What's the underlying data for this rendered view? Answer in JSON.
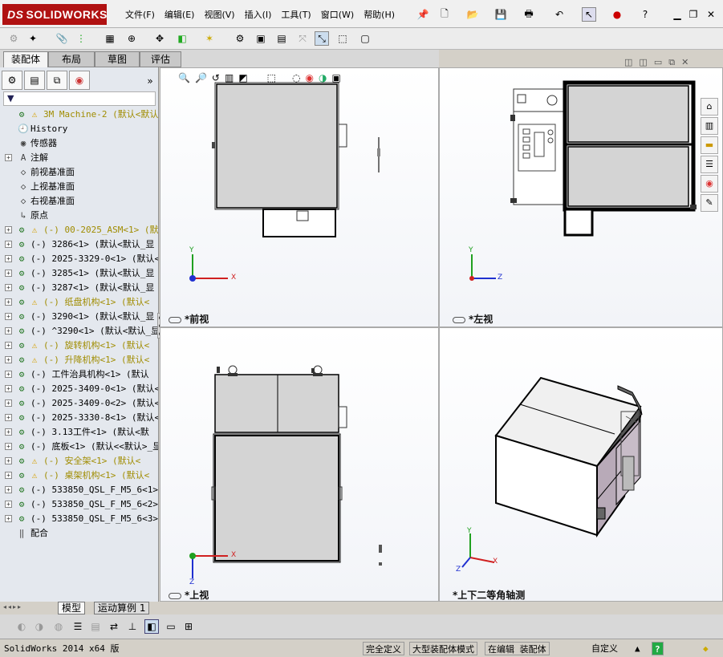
{
  "app": {
    "logo_prefix": "DS",
    "logo_text": "SOLIDWORKS"
  },
  "menu": [
    "文件(F)",
    "编辑(E)",
    "视图(V)",
    "插入(I)",
    "工具(T)",
    "窗口(W)",
    "帮助(H)"
  ],
  "command_tabs": [
    "装配体",
    "布局",
    "草图",
    "评估"
  ],
  "tree": {
    "filter_icon": "filter-icon",
    "items": [
      {
        "label": "3M Machine-2  (默认<默认_显",
        "icon": "assembly-icon",
        "warn": true,
        "expand": false
      },
      {
        "label": "History",
        "icon": "history-icon",
        "warn": false,
        "expand": false
      },
      {
        "label": "传感器",
        "icon": "sensor-icon",
        "warn": false,
        "expand": false
      },
      {
        "label": "注解",
        "icon": "annotation-icon",
        "warn": false,
        "expand": true
      },
      {
        "label": "前视基准面",
        "icon": "plane-icon",
        "warn": false,
        "expand": false
      },
      {
        "label": "上视基准面",
        "icon": "plane-icon",
        "warn": false,
        "expand": false
      },
      {
        "label": "右视基准面",
        "icon": "plane-icon",
        "warn": false,
        "expand": false
      },
      {
        "label": "原点",
        "icon": "origin-icon",
        "warn": false,
        "expand": false
      },
      {
        "label": "(-) 00-2025_ASM<1> (默认",
        "icon": "assembly-icon",
        "warn": true,
        "expand": true
      },
      {
        "label": "(-) 3286<1> (默认<默认_显",
        "icon": "part-icon",
        "warn": false,
        "expand": true
      },
      {
        "label": "(-) 2025-3329-0<1> (默认<",
        "icon": "part-icon",
        "warn": false,
        "expand": true
      },
      {
        "label": "(-) 3285<1> (默认<默认_显",
        "icon": "part-icon",
        "warn": false,
        "expand": true
      },
      {
        "label": "(-) 3287<1> (默认<默认_显",
        "icon": "part-icon",
        "warn": false,
        "expand": true
      },
      {
        "label": "(-) 纸盘机构<1> (默认<",
        "icon": "assembly-icon",
        "warn": true,
        "expand": true
      },
      {
        "label": "(-) 3290<1> (默认<默认_显",
        "icon": "part-icon",
        "warn": false,
        "expand": true
      },
      {
        "label": "(-) ^3290<1> (默认<默认_显",
        "icon": "part-icon",
        "warn": false,
        "expand": true
      },
      {
        "label": "(-) 旋转机构<1> (默认<",
        "icon": "assembly-icon",
        "warn": true,
        "expand": true
      },
      {
        "label": "(-) 升降机构<1> (默认<",
        "icon": "assembly-icon",
        "warn": true,
        "expand": true
      },
      {
        "label": "(-) 工件治具机构<1> (默认",
        "icon": "part-icon",
        "warn": false,
        "expand": true
      },
      {
        "label": "(-) 2025-3409-0<1> (默认<",
        "icon": "part-icon",
        "warn": false,
        "expand": true
      },
      {
        "label": "(-) 2025-3409-0<2> (默认<",
        "icon": "part-icon",
        "warn": false,
        "expand": true
      },
      {
        "label": "(-) 2025-3330-8<1> (默认<",
        "icon": "part-icon",
        "warn": false,
        "expand": true
      },
      {
        "label": "(-) 3.13工件<1> (默认<默",
        "icon": "part-icon",
        "warn": false,
        "expand": true
      },
      {
        "label": "(-) 底板<1> (默认<<默认>_显",
        "icon": "part-icon",
        "warn": false,
        "expand": true
      },
      {
        "label": "(-) 安全架<1> (默认<",
        "icon": "assembly-icon",
        "warn": true,
        "expand": true
      },
      {
        "label": "(-) 桌架机构<1> (默认<",
        "icon": "assembly-icon",
        "warn": true,
        "expand": true
      },
      {
        "label": "(-) 533850_QSL_F_M5_6<1>",
        "icon": "part-icon",
        "warn": false,
        "expand": true
      },
      {
        "label": "(-) 533850_QSL_F_M5_6<2>",
        "icon": "part-icon",
        "warn": false,
        "expand": true
      },
      {
        "label": "(-) 533850_QSL_F_M5_6<3>",
        "icon": "part-icon",
        "warn": false,
        "expand": true
      },
      {
        "label": "配合",
        "icon": "mates-icon",
        "warn": false,
        "expand": false
      }
    ]
  },
  "viewports": {
    "front": "*前视",
    "left": "*左视",
    "top": "*上视",
    "iso": "*上下二等角轴测"
  },
  "axes": {
    "x": "X",
    "y": "Y",
    "z": "Z"
  },
  "bottom_tabs": [
    "模型",
    "运动算例 1"
  ],
  "status": {
    "app": "SolidWorks 2014 x64 版",
    "defined": "完全定义",
    "mode": "大型装配体模式",
    "editing": "在编辑 装配体",
    "units": "自定义",
    "help": "?"
  },
  "colors": {
    "brand": "#b01111",
    "axis_x": "#d02020",
    "axis_y": "#20a020",
    "axis_z": "#2030d0",
    "warn": "#a08c00",
    "panel_purple": "#b8aab8"
  }
}
